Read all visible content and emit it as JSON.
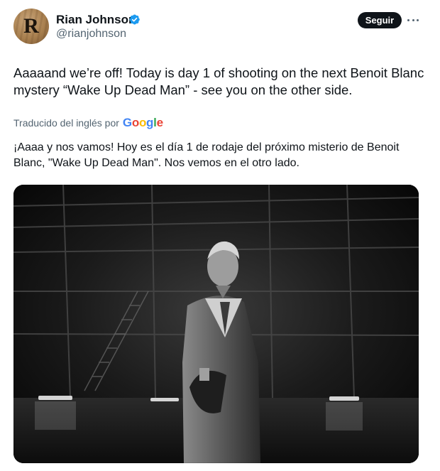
{
  "author": {
    "display_name": "Rian Johnson",
    "handle": "@rianjohnson",
    "avatar_letter": "R",
    "verified_color": "#1d9bf0"
  },
  "actions": {
    "follow_label": "Seguir",
    "more_icon": "more-horizontal-icon"
  },
  "tweet": {
    "text": "Aaaaand we’re off! Today is day 1 of shooting on the next Benoit Blanc mystery “Wake Up Dead Man” - see you on the other side."
  },
  "translation": {
    "label": "Traducido del inglés por",
    "provider": "Google",
    "text": "¡Aaaa y nos vamos! Hoy es el día 1 de rodaje del próximo misterio de Benoit Blanc, \"Wake Up Dead Man\". Nos vemos en el otro lado."
  },
  "colors": {
    "text_primary": "#0f1419",
    "text_secondary": "#536471",
    "button_bg": "#0f1419"
  }
}
